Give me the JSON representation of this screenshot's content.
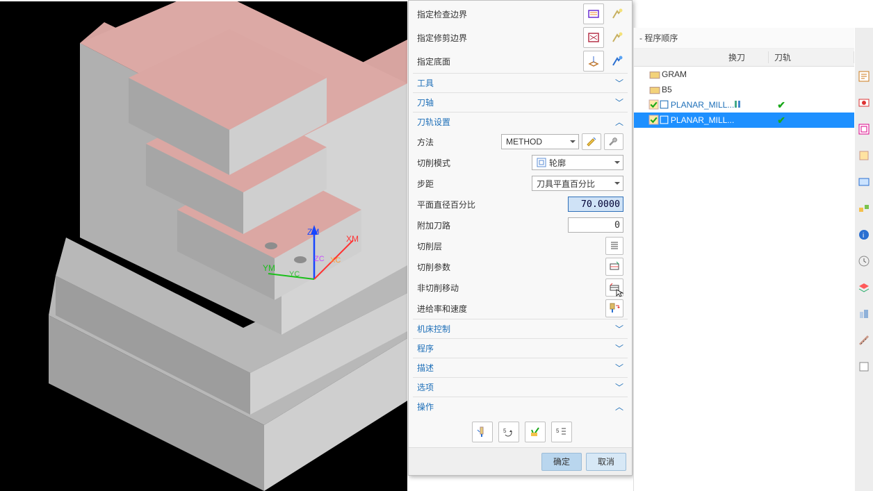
{
  "dialog": {
    "boundary_rows": [
      {
        "label": "指定检查边界",
        "k1": "check-boundary-icon",
        "k2": "torch-icon"
      },
      {
        "label": "指定修剪边界",
        "k1": "trim-boundary-icon",
        "k2": "torch-icon"
      },
      {
        "label": "指定底面",
        "k1": "floor-plane-icon",
        "k2": "torch-icon"
      }
    ],
    "sections": {
      "tool": "工具",
      "axis": "刀轴",
      "path": "刀轨设置",
      "mc_control": "机床控制",
      "program": "程序",
      "desc": "描述",
      "options": "选项",
      "actions": "操作"
    },
    "path": {
      "method_label": "方法",
      "method_value": "METHOD",
      "cut_mode_label": "切削模式",
      "cut_mode_value": "轮廓",
      "step_label": "步距",
      "step_value": "刀具平直百分比",
      "flat_pct_label": "平面直径百分比",
      "flat_pct_value": "70.0000",
      "extra_paths_label": "附加刀路",
      "extra_paths_value": "0",
      "cut_levels_label": "切削层",
      "cut_params_label": "切削参数",
      "noncut_label": "非切削移动",
      "feed_label": "进给率和速度"
    },
    "ok": "确定",
    "cancel": "取消"
  },
  "tree": {
    "title_suffix": "- 程序顺序",
    "cols": {
      "tool": "换刀",
      "track": "刀轨"
    },
    "rows": [
      {
        "type": "group",
        "label": "GRAM"
      },
      {
        "type": "group",
        "label": "B5"
      },
      {
        "type": "op",
        "label": "PLANAR_MILL...",
        "tool_icon": true,
        "track_ok": true,
        "sel": false
      },
      {
        "type": "op",
        "label": "PLANAR_MILL...",
        "tool_icon": false,
        "track_ok": true,
        "sel": true
      }
    ]
  },
  "viewport_axes": {
    "x": "XM",
    "y": "YM",
    "z": "ZM",
    "xc": "XC",
    "yc": "YC",
    "zc": "ZC"
  }
}
